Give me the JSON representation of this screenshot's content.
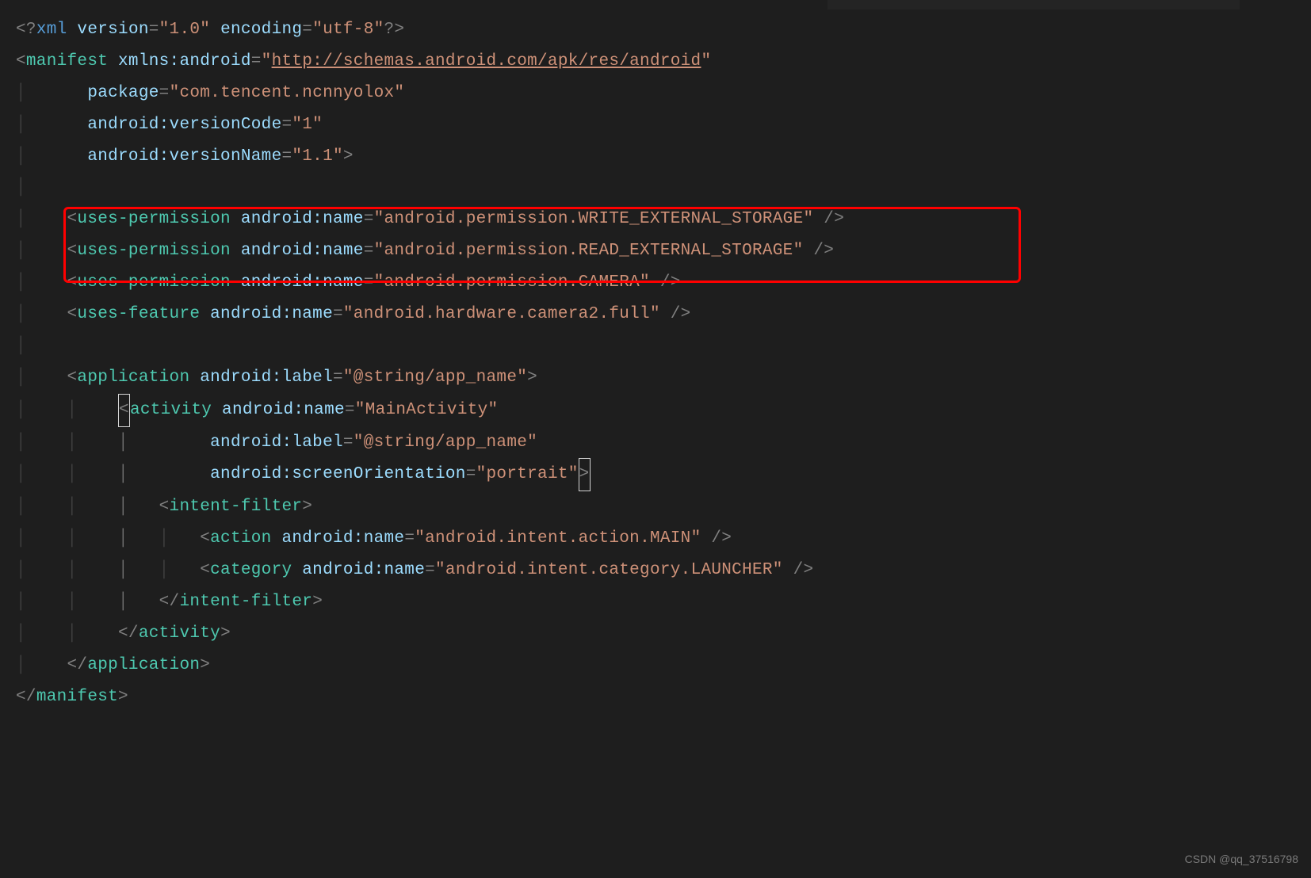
{
  "watermark": "CSDN @qq_37516798",
  "code": {
    "l1": {
      "open": "<?",
      "xml": "xml",
      "version_attr": " version",
      "eq": "=",
      "version_val": "\"1.0\"",
      "encoding_attr": " encoding",
      "encoding_val": "\"utf-8\"",
      "close": "?>"
    },
    "l2": {
      "lt": "<",
      "tag": "manifest",
      "xmlns_attr": " xmlns:android",
      "eq": "=",
      "q1": "\"",
      "url": "http://schemas.android.com/apk/res/android",
      "q2": "\""
    },
    "l3": {
      "attr": "package",
      "val": "\"com.tencent.ncnnyolox\""
    },
    "l4": {
      "attr": "android:versionCode",
      "val": "\"1\""
    },
    "l5": {
      "attr": "android:versionName",
      "val": "\"1.1\"",
      "gt": ">"
    },
    "l7": {
      "tag": "uses-permission",
      "attr": " android:name",
      "val": "\"android.permission.WRITE_EXTERNAL_STORAGE\"",
      "close": " />"
    },
    "l8": {
      "tag": "uses-permission",
      "attr": " android:name",
      "val": "\"android.permission.READ_EXTERNAL_STORAGE\"",
      "close": " />"
    },
    "l9": {
      "tag": "uses-permission",
      "attr": " android:name",
      "val": "\"android.permission.CAMERA\"",
      "close": " />"
    },
    "l10": {
      "tag": "uses-feature",
      "attr": " android:name",
      "val": "\"android.hardware.camera2.full\"",
      "close": " />"
    },
    "l12": {
      "tag": "application",
      "attr": " android:label",
      "val": "\"@string/app_name\"",
      "gt": ">"
    },
    "l13": {
      "tag": "activity",
      "attr": " android:name",
      "val": "\"MainActivity\""
    },
    "l14": {
      "attr": "android:label",
      "val": "\"@string/app_name\""
    },
    "l15": {
      "attr": "android:screenOrientation",
      "val": "\"portrait\"",
      "gt": ">"
    },
    "l16": {
      "tag": "intent-filter",
      "gt": ">"
    },
    "l17": {
      "tag": "action",
      "attr": " android:name",
      "val": "\"android.intent.action.MAIN\"",
      "close": " />"
    },
    "l18": {
      "tag": "category",
      "attr": " android:name",
      "val": "\"android.intent.category.LAUNCHER\"",
      "close": " />"
    },
    "l19": {
      "tag": "intent-filter"
    },
    "l20": {
      "tag": "activity"
    },
    "l21": {
      "tag": "application"
    },
    "l22": {
      "tag": "manifest"
    }
  }
}
